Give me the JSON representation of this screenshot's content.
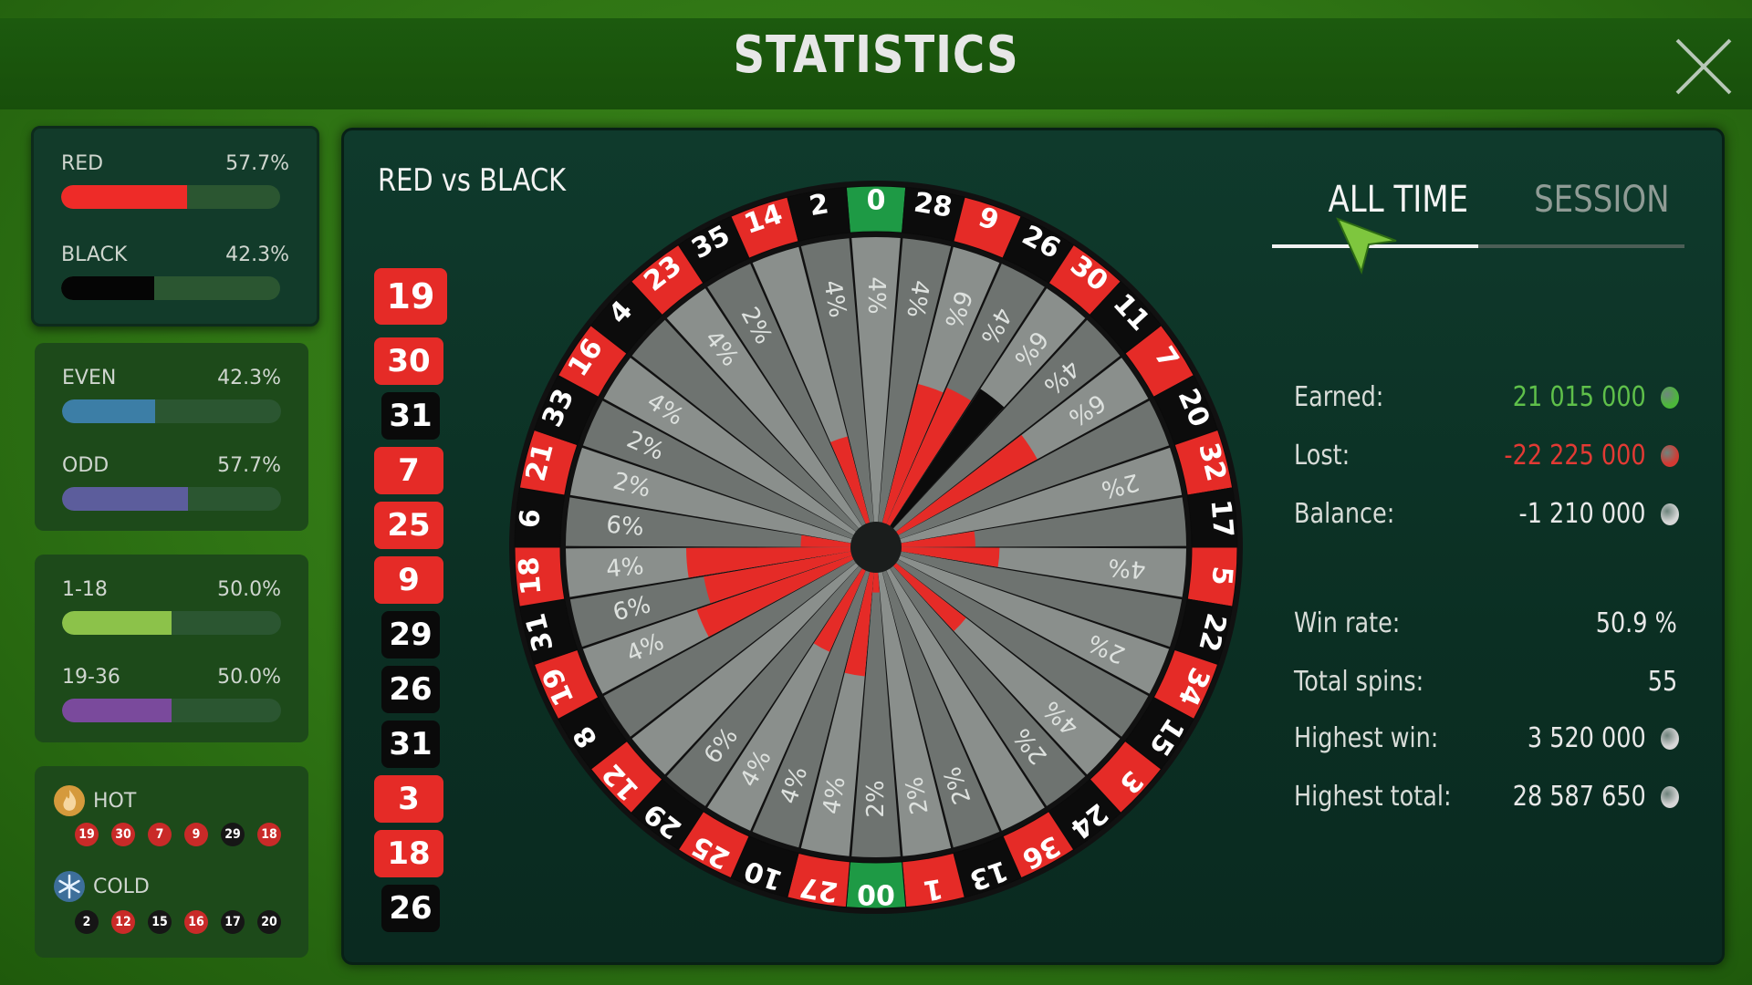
{
  "title": "STATISTICS",
  "left": {
    "red_black": [
      {
        "label": "RED",
        "pct": "57.7%",
        "value": 0.577,
        "color": "#ee2b28"
      },
      {
        "label": "BLACK",
        "pct": "42.3%",
        "value": 0.423,
        "color": "#050505"
      }
    ],
    "even_odd": [
      {
        "label": "EVEN",
        "pct": "42.3%",
        "value": 0.423,
        "color": "#3c7ea6"
      },
      {
        "label": "ODD",
        "pct": "57.7%",
        "value": 0.577,
        "color": "#5c5d9c"
      }
    ],
    "halves": [
      {
        "label": "1-18",
        "pct": "50.0%",
        "value": 0.5,
        "color": "#8cc24a"
      },
      {
        "label": "19-36",
        "pct": "50.0%",
        "value": 0.5,
        "color": "#7a4a9c"
      }
    ],
    "hot": {
      "label": "HOT",
      "numbers": [
        {
          "n": "19",
          "c": "red"
        },
        {
          "n": "30",
          "c": "red"
        },
        {
          "n": "7",
          "c": "red"
        },
        {
          "n": "9",
          "c": "red"
        },
        {
          "n": "29",
          "c": "black"
        },
        {
          "n": "18",
          "c": "red"
        }
      ]
    },
    "cold": {
      "label": "COLD",
      "numbers": [
        {
          "n": "2",
          "c": "black"
        },
        {
          "n": "12",
          "c": "red"
        },
        {
          "n": "15",
          "c": "black"
        },
        {
          "n": "16",
          "c": "red"
        },
        {
          "n": "17",
          "c": "black"
        },
        {
          "n": "20",
          "c": "black"
        }
      ]
    }
  },
  "main": {
    "title": "RED vs BLACK",
    "history": [
      {
        "n": "19",
        "c": "red"
      },
      {
        "n": "30",
        "c": "red"
      },
      {
        "n": "31",
        "c": "black"
      },
      {
        "n": "7",
        "c": "red"
      },
      {
        "n": "25",
        "c": "red"
      },
      {
        "n": "9",
        "c": "red"
      },
      {
        "n": "29",
        "c": "black"
      },
      {
        "n": "26",
        "c": "black"
      },
      {
        "n": "31",
        "c": "black"
      },
      {
        "n": "3",
        "c": "red"
      },
      {
        "n": "18",
        "c": "red"
      },
      {
        "n": "26",
        "c": "black"
      }
    ],
    "tabs": [
      {
        "label": "ALL TIME",
        "active": true
      },
      {
        "label": "SESSION",
        "active": false
      }
    ],
    "stats": [
      {
        "key": "Earned:",
        "value": "21 015 000",
        "color": "#5fc04a",
        "coin": "#4cb83a"
      },
      {
        "key": "Lost:",
        "value": "-22 225 000",
        "color": "#e23a34",
        "coin": "#d33a33"
      },
      {
        "key": "Balance:",
        "value": "-1 210 000",
        "color": "#e8e8e8",
        "coin": "#d6d6d6"
      },
      {
        "key": "Win rate:",
        "value": "50.9 %",
        "color": "#e8e8e8",
        "coin": ""
      },
      {
        "key": "Total spins:",
        "value": "55",
        "color": "#e8e8e8",
        "coin": ""
      },
      {
        "key": "Highest win:",
        "value": "3 520 000",
        "color": "#e8e8e8",
        "coin": "#d6d6d6"
      },
      {
        "key": "Highest total:",
        "value": "28 587 650",
        "color": "#e8e8e8",
        "coin": "#d6d6d6"
      }
    ]
  },
  "wheel": {
    "pockets": [
      {
        "n": "0",
        "c": "green",
        "pct": "4%",
        "lv": 0.0,
        "pc": "black"
      },
      {
        "n": "28",
        "c": "black",
        "pct": "4%",
        "lv": 0.0,
        "pc": "red"
      },
      {
        "n": "9",
        "c": "red",
        "pct": "6%",
        "lv": 0.53,
        "pc": "red"
      },
      {
        "n": "26",
        "c": "black",
        "pct": "4%",
        "lv": 0.55,
        "pc": "red"
      },
      {
        "n": "30",
        "c": "red",
        "pct": "6%",
        "lv": 0.6,
        "pc": "black"
      },
      {
        "n": "11",
        "c": "black",
        "pct": "4%",
        "lv": 0.0,
        "pc": "black"
      },
      {
        "n": "7",
        "c": "red",
        "pct": "6%",
        "lv": 0.58,
        "pc": "red"
      },
      {
        "n": "20",
        "c": "black",
        "pct": "",
        "lv": 0.0,
        "pc": "black"
      },
      {
        "n": "32",
        "c": "red",
        "pct": "2%",
        "lv": 0.0,
        "pc": "black"
      },
      {
        "n": "17",
        "c": "black",
        "pct": "",
        "lv": 0.3,
        "pc": "red"
      },
      {
        "n": "5",
        "c": "red",
        "pct": "4%",
        "lv": 0.38,
        "pc": "red"
      },
      {
        "n": "22",
        "c": "black",
        "pct": "",
        "lv": 0.0,
        "pc": "black"
      },
      {
        "n": "34",
        "c": "red",
        "pct": "2%",
        "lv": 0.0,
        "pc": "black"
      },
      {
        "n": "15",
        "c": "black",
        "pct": "",
        "lv": 0.0,
        "pc": "black"
      },
      {
        "n": "3",
        "c": "red",
        "pct": "4%",
        "lv": 0.35,
        "pc": "red"
      },
      {
        "n": "24",
        "c": "black",
        "pct": "2%",
        "lv": 0.0,
        "pc": "black"
      },
      {
        "n": "36",
        "c": "red",
        "pct": "",
        "lv": 0.0,
        "pc": "black"
      },
      {
        "n": "13",
        "c": "black",
        "pct": "2%",
        "lv": 0.0,
        "pc": "black"
      },
      {
        "n": "1",
        "c": "red",
        "pct": "2%",
        "lv": 0.0,
        "pc": "black"
      },
      {
        "n": "00",
        "c": "green",
        "pct": "2%",
        "lv": 0.12,
        "pc": "red"
      },
      {
        "n": "27",
        "c": "red",
        "pct": "4%",
        "lv": 0.4,
        "pc": "red"
      },
      {
        "n": "10",
        "c": "black",
        "pct": "4%",
        "lv": 0.0,
        "pc": "black"
      },
      {
        "n": "25",
        "c": "red",
        "pct": "4%",
        "lv": 0.35,
        "pc": "red"
      },
      {
        "n": "29",
        "c": "black",
        "pct": "6%",
        "lv": 0.0,
        "pc": "black"
      },
      {
        "n": "12",
        "c": "red",
        "pct": "",
        "lv": 0.0,
        "pc": "black"
      },
      {
        "n": "8",
        "c": "black",
        "pct": "",
        "lv": 0.0,
        "pc": "black"
      },
      {
        "n": "19",
        "c": "red",
        "pct": "4%",
        "lv": 0.6,
        "pc": "red"
      },
      {
        "n": "31",
        "c": "black",
        "pct": "6%",
        "lv": 0.55,
        "pc": "red"
      },
      {
        "n": "18",
        "c": "red",
        "pct": "4%",
        "lv": 0.6,
        "pc": "red"
      },
      {
        "n": "6",
        "c": "black",
        "pct": "6%",
        "lv": 0.22,
        "pc": "red"
      },
      {
        "n": "21",
        "c": "red",
        "pct": "2%",
        "lv": 0.0,
        "pc": "black"
      },
      {
        "n": "33",
        "c": "black",
        "pct": "2%",
        "lv": 0.0,
        "pc": "black"
      },
      {
        "n": "16",
        "c": "red",
        "pct": "4%",
        "lv": 0.0,
        "pc": "black"
      },
      {
        "n": "4",
        "c": "black",
        "pct": "",
        "lv": 0.0,
        "pc": "black"
      },
      {
        "n": "23",
        "c": "red",
        "pct": "4%",
        "lv": 0.0,
        "pc": "black"
      },
      {
        "n": "35",
        "c": "black",
        "pct": "2%",
        "lv": 0.0,
        "pc": "black"
      },
      {
        "n": "14",
        "c": "red",
        "pct": "",
        "lv": 0.35,
        "pc": "red"
      },
      {
        "n": "2",
        "c": "black",
        "pct": "4%",
        "lv": 0.0,
        "pc": "black"
      }
    ]
  }
}
